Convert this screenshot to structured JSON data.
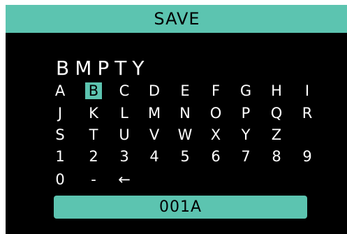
{
  "title": "SAVE",
  "name_entry": "BMPTY",
  "keyboard": {
    "rows": [
      [
        "A",
        "B",
        "C",
        "D",
        "E",
        "F",
        "G",
        "H",
        "I"
      ],
      [
        "J",
        "K",
        "L",
        "M",
        "N",
        "O",
        "P",
        "Q",
        "R"
      ],
      [
        "S",
        "T",
        "U",
        "V",
        "W",
        "X",
        "Y",
        "Z"
      ],
      [
        "1",
        "2",
        "3",
        "4",
        "5",
        "6",
        "7",
        "8",
        "9"
      ],
      [
        "0",
        "-",
        "←"
      ]
    ],
    "selected": "B"
  },
  "save_slot": "001A",
  "colors": {
    "accent": "#5cc4b0",
    "background": "#000000",
    "text": "#ffffff"
  }
}
